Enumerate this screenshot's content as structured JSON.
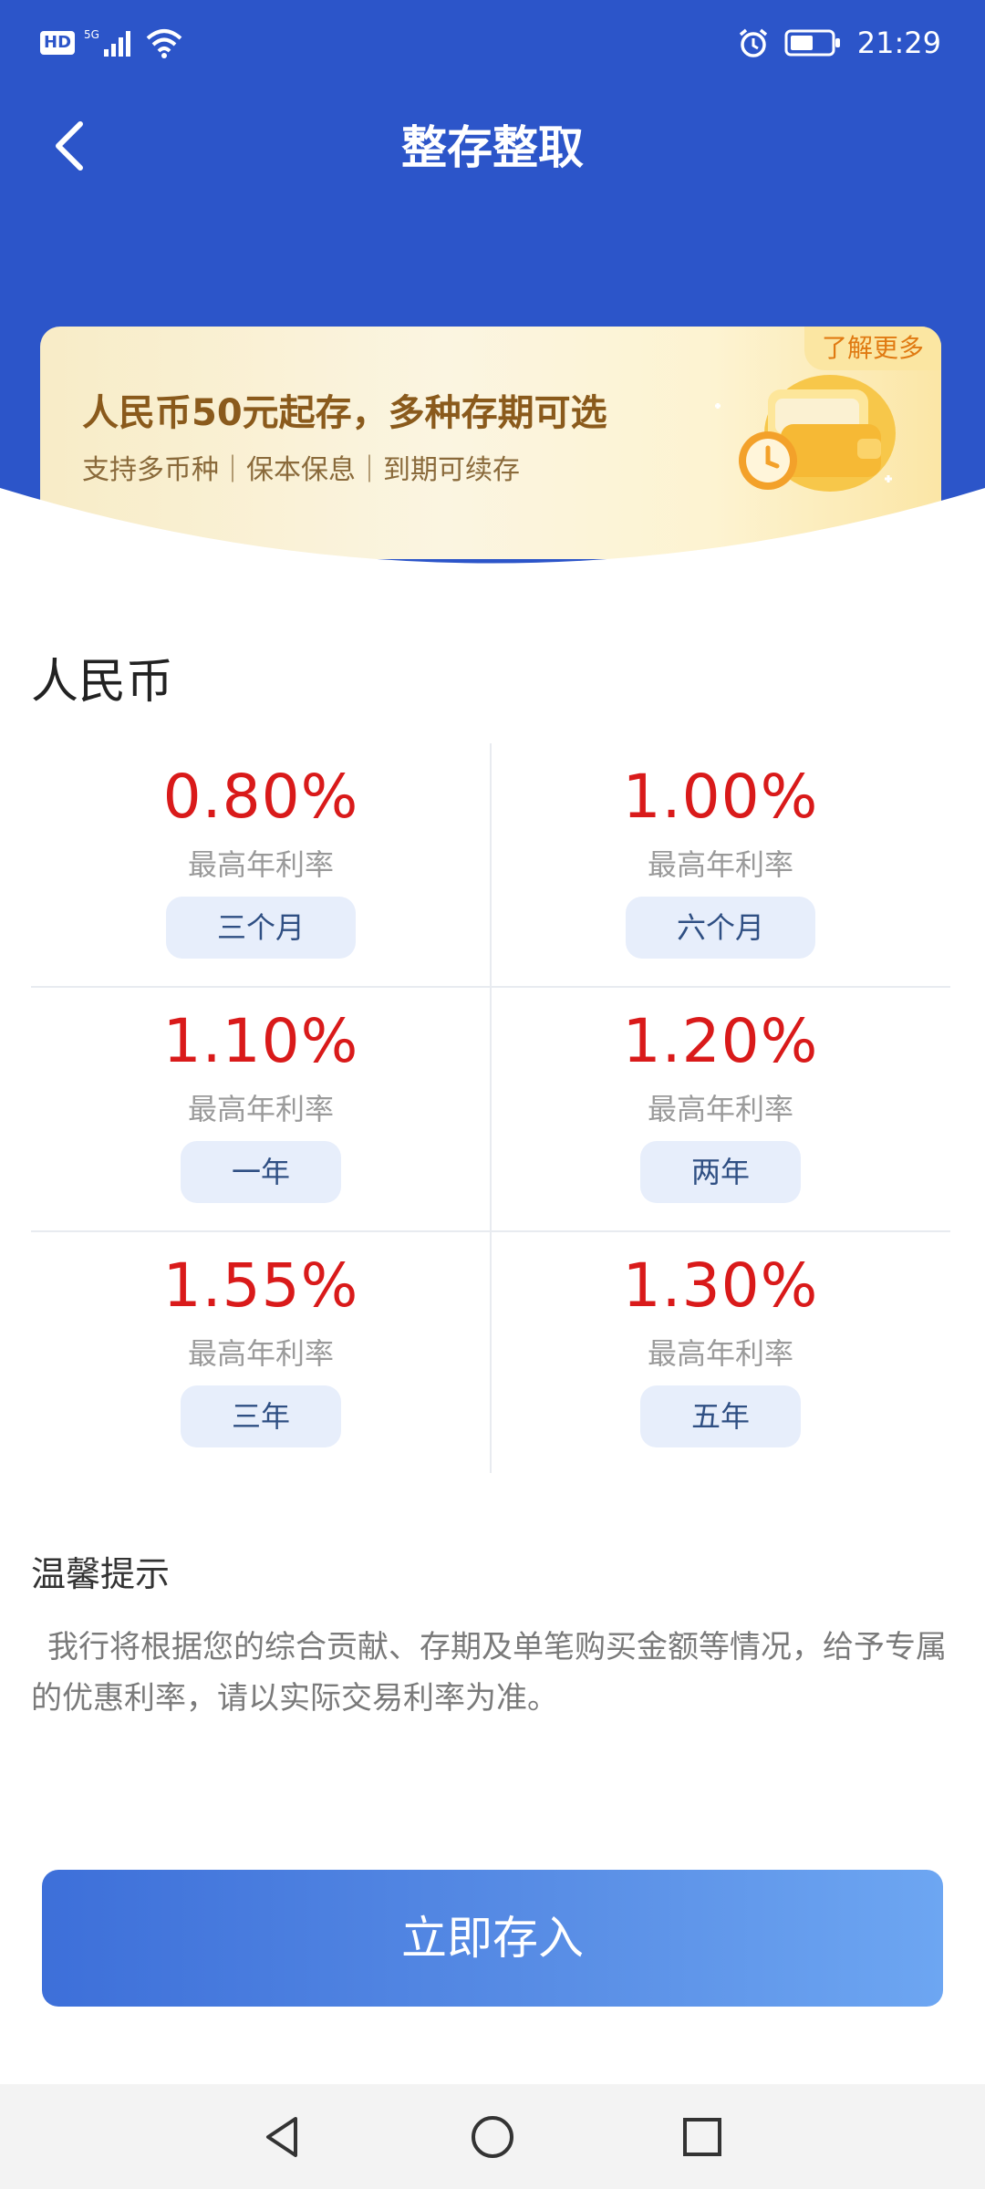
{
  "status_bar": {
    "hd": "HD",
    "signal": "5G",
    "time": "21:29",
    "icons": [
      "signal-icon",
      "wifi-icon",
      "alarm-icon",
      "battery-icon"
    ]
  },
  "nav": {
    "title": "整存整取",
    "back_icon": "back-arrow-icon"
  },
  "banner": {
    "headline": "人民币50元起存，多种存期可选",
    "subtitle": "支持多币种｜保本保息｜到期可续存",
    "learn_more": "了解更多",
    "illustration": "wallet-clock-icon"
  },
  "currency": {
    "title": "人民币",
    "rates": [
      {
        "rate": "0.80%",
        "label": "最高年利率",
        "term": "三个月"
      },
      {
        "rate": "1.00%",
        "label": "最高年利率",
        "term": "六个月"
      },
      {
        "rate": "1.10%",
        "label": "最高年利率",
        "term": "一年"
      },
      {
        "rate": "1.20%",
        "label": "最高年利率",
        "term": "两年"
      },
      {
        "rate": "1.55%",
        "label": "最高年利率",
        "term": "三年"
      },
      {
        "rate": "1.30%",
        "label": "最高年利率",
        "term": "五年"
      }
    ]
  },
  "tips": {
    "title": "温馨提示",
    "text": "我行将根据您的综合贡献、存期及单笔购买金额等情况，给予专属的优惠利率，请以实际交易利率为准。"
  },
  "cta": {
    "label": "立即存入"
  },
  "system_nav": [
    "back-triangle-icon",
    "home-circle-icon",
    "recents-square-icon"
  ],
  "colors": {
    "header_blue": "#2c55c9",
    "rate_red": "#d91a1a",
    "tag_bg": "#e7eefb",
    "cta_start": "#3d6fd9",
    "cta_end": "#6da6f2"
  }
}
